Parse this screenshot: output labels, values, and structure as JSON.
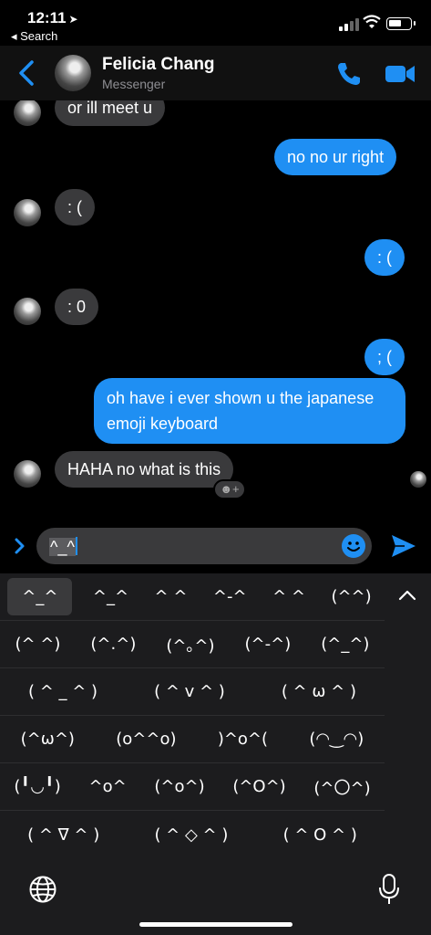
{
  "status_bar": {
    "time": "12:11",
    "location_glyph": "➤",
    "back_app": "◂ Search"
  },
  "header": {
    "contact_name": "Felicia Chang",
    "contact_subtitle": "Messenger",
    "icons": [
      "back-chevron-icon",
      "phone-icon",
      "video-camera-icon"
    ],
    "accent_color": "#1f8ff3"
  },
  "messages": [
    {
      "side": "in",
      "text": "or ill meet u"
    },
    {
      "side": "out",
      "text": "no no ur right"
    },
    {
      "side": "in",
      "text": ": ("
    },
    {
      "side": "out",
      "text": ": ("
    },
    {
      "side": "in",
      "text": ": 0"
    },
    {
      "side": "out",
      "text": "; ("
    },
    {
      "side": "out",
      "text": "oh have i ever shown u the japanese emoji keyboard"
    },
    {
      "side": "in",
      "text": "HAHA no what is this"
    }
  ],
  "reaction_button": "☻+",
  "composer": {
    "value_highlight": "^_^",
    "icons": [
      "expand-chevron-icon",
      "emoji-smiley-icon",
      "send-arrow-icon"
    ]
  },
  "keyboard": {
    "rows": [
      [
        "^_^",
        "^_^",
        "^ ^",
        "^-^",
        "^ ^",
        "(^^)"
      ],
      [
        "(^ ^)",
        "(^.^)",
        "(^｡^)",
        "(^-^)",
        "(^_^)"
      ],
      [
        "( ^ _ ^ )",
        "( ^ v ^ )",
        "( ^ ω ^ )"
      ],
      [
        "(^ω^)",
        "(o^^o)",
        ")^o^(",
        "(◠‿◠)"
      ],
      [
        "(╹◡╹)",
        "^o^",
        "(^o^)",
        "(^O^)",
        "(^〇^)"
      ],
      [
        "( ^ ∇ ^ )",
        "( ^ ◇ ^ )",
        "( ^ O ^ )"
      ]
    ],
    "icons": [
      "collapse-chevron-icon",
      "globe-icon",
      "microphone-icon"
    ]
  }
}
